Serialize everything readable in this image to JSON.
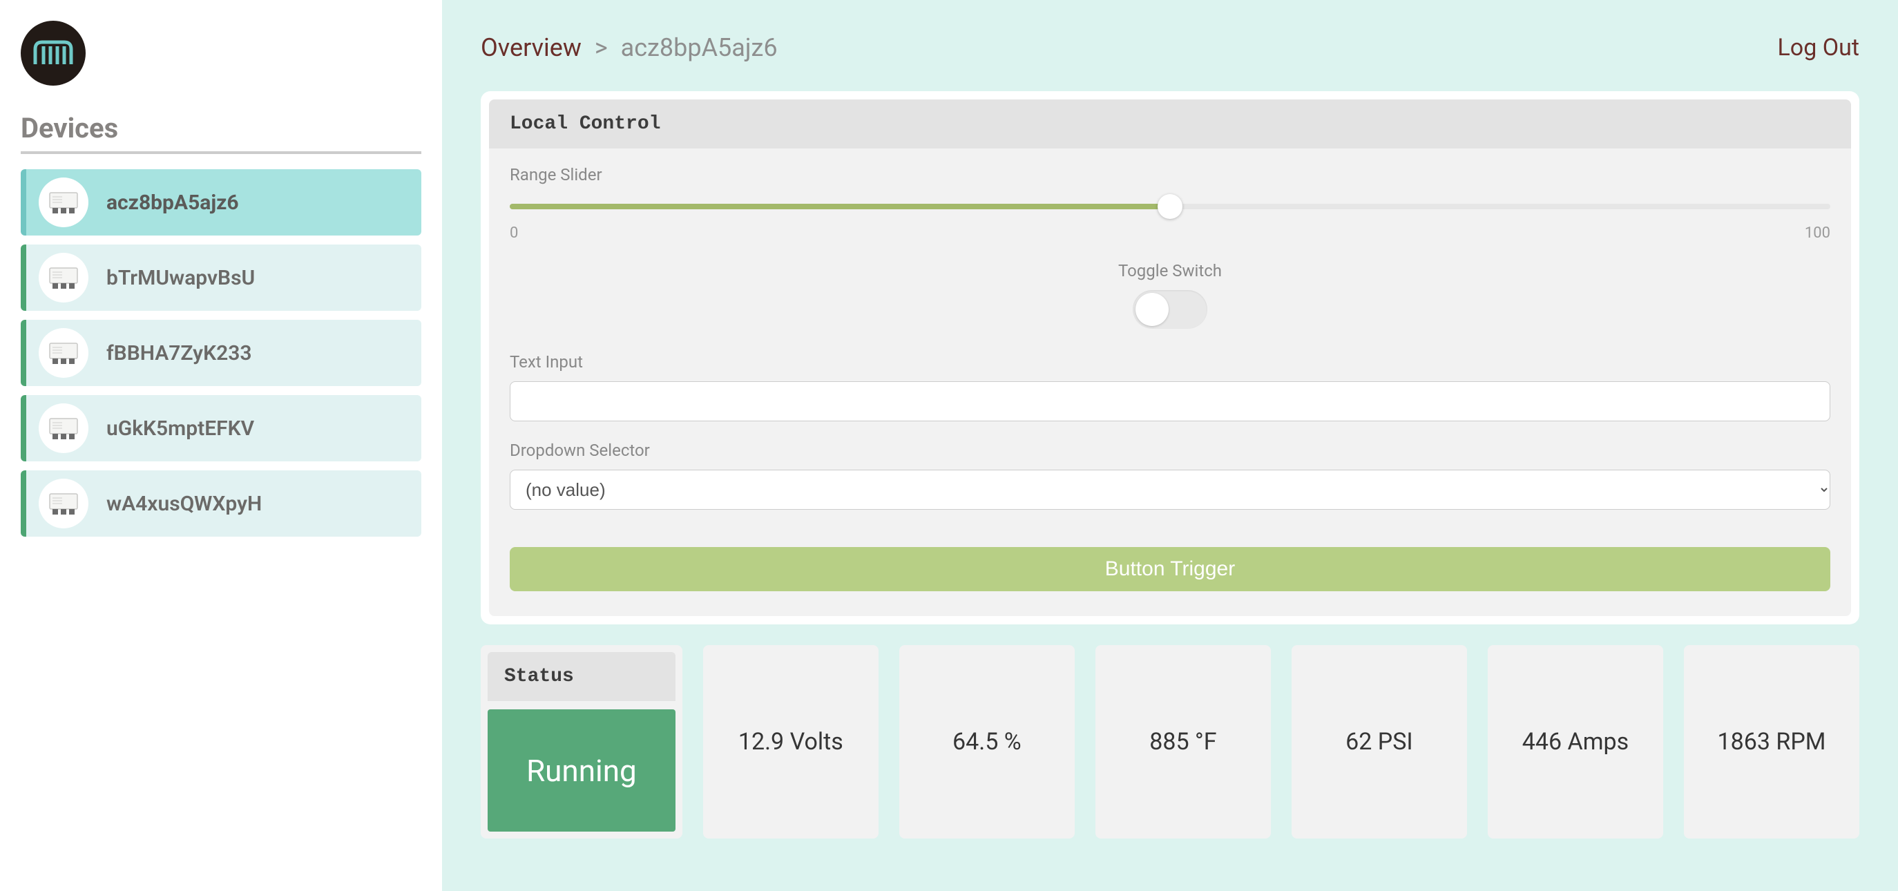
{
  "sidebar": {
    "title": "Devices",
    "items": [
      {
        "id": "acz8bpA5ajz6",
        "active": true
      },
      {
        "id": "bTrMUwapvBsU",
        "active": false
      },
      {
        "id": "fBBHA7ZyK233",
        "active": false
      },
      {
        "id": "uGkK5mptEFKV",
        "active": false
      },
      {
        "id": "wA4xusQWXpyH",
        "active": false
      }
    ]
  },
  "breadcrumb": {
    "root": "Overview",
    "sep": ">",
    "leaf": "acz8bpA5ajz6"
  },
  "logout": "Log Out",
  "local_control": {
    "title": "Local Control",
    "slider": {
      "label": "Range Slider",
      "min": "0",
      "max": "100",
      "value": 50,
      "percent": 50
    },
    "toggle": {
      "label": "Toggle Switch",
      "on": false
    },
    "text": {
      "label": "Text Input",
      "value": ""
    },
    "dropdown": {
      "label": "Dropdown Selector",
      "selected": "(no value)"
    },
    "button": {
      "label": "Button Trigger"
    }
  },
  "status": {
    "title": "Status",
    "value": "Running",
    "color": "#57a879"
  },
  "metrics": [
    {
      "text": "12.9 Volts"
    },
    {
      "text": "64.5 %"
    },
    {
      "text": "885 °F"
    },
    {
      "text": "62 PSI"
    },
    {
      "text": "446 Amps"
    },
    {
      "text": "1863 RPM"
    }
  ]
}
